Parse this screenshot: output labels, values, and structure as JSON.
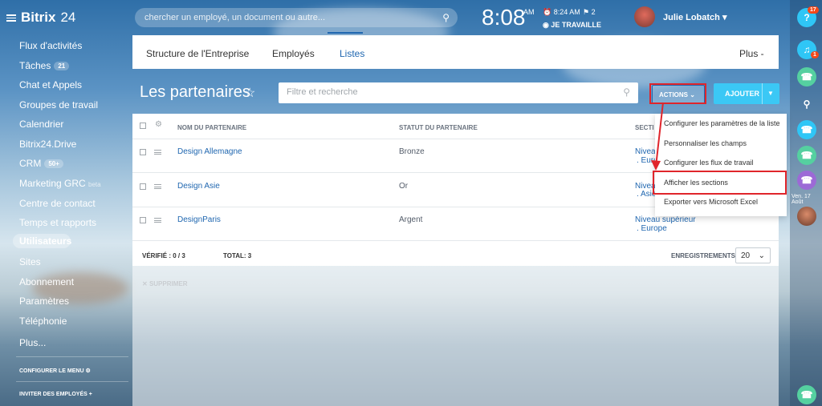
{
  "header": {
    "logo_name": "Bitrix",
    "logo_num": "24",
    "search_placeholder": "chercher un employé, un document ou autre...",
    "clock": "8:08",
    "ampm": "AM",
    "alarm": "8:24 AM",
    "messages": "2",
    "work_status": "JE TRAVAILLE",
    "user_name": "Julie Lobatch"
  },
  "sidebar": {
    "items": [
      {
        "label": "Flux d'activités"
      },
      {
        "label": "Tâches",
        "badge": "21"
      },
      {
        "label": "Chat et Appels"
      },
      {
        "label": "Groupes de travail"
      },
      {
        "label": "Calendrier"
      },
      {
        "label": "Bitrix24.Drive"
      },
      {
        "label": "CRM",
        "badge": "50+"
      },
      {
        "label": "Marketing GRC",
        "extra": "beta"
      },
      {
        "label": "Centre de contact"
      },
      {
        "label": "Temps et rapports"
      },
      {
        "label": "Utilisateurs"
      },
      {
        "label": "Sites"
      },
      {
        "label": "Abonnement"
      },
      {
        "label": "Paramètres"
      },
      {
        "label": "Téléphonie"
      },
      {
        "label": "Plus..."
      }
    ],
    "configure_menu": "CONFIGURER LE MENU",
    "invite": "INVITER DES EMPLOYÉS"
  },
  "tabs": {
    "structure": "Structure de l'Entreprise",
    "employees": "Employés",
    "lists": "Listes",
    "more": "Plus -"
  },
  "toolbar": {
    "title": "Les partenaires",
    "filter_placeholder": "Filtre et recherche",
    "actions_label": "ACTIONS",
    "add_label": "AJOUTER"
  },
  "table": {
    "headers": {
      "name": "NOM DU PARTENAIRE",
      "status": "STATUT DU PARTENAIRE",
      "section": "SECTI"
    },
    "rows": [
      {
        "name": "Design Allemagne",
        "status": "Bronze",
        "section1": "Niveau",
        "section2": ". Euro"
      },
      {
        "name": "Design Asie",
        "status": "Or",
        "section1": "Niveau",
        "section2": ". Asie"
      },
      {
        "name": "DesignParis",
        "status": "Argent",
        "section1": "Niveau supérieur",
        "section2": ". Europe"
      }
    ],
    "verified": "VÉRIFIÉ : 0 / 3",
    "total": "TOTAL: 3",
    "records_label": "ENREGISTREMENTS :",
    "per_page": "20",
    "delete": "SUPPRIMER"
  },
  "menu": {
    "items": [
      "Configurer les paramètres de la liste",
      "Personnaliser les champs",
      "Configurer les flux de travail",
      "Afficher les sections",
      "Exporter vers Microsoft Excel"
    ]
  },
  "rightbar": {
    "help_badge": "17",
    "notif_badge": "1",
    "date": "Ven. 17 Août"
  },
  "colors": {
    "accent": "#2067b0",
    "add_button": "#3bc8f5",
    "highlight": "#e0252b",
    "phone_green": "#55d0a0"
  }
}
